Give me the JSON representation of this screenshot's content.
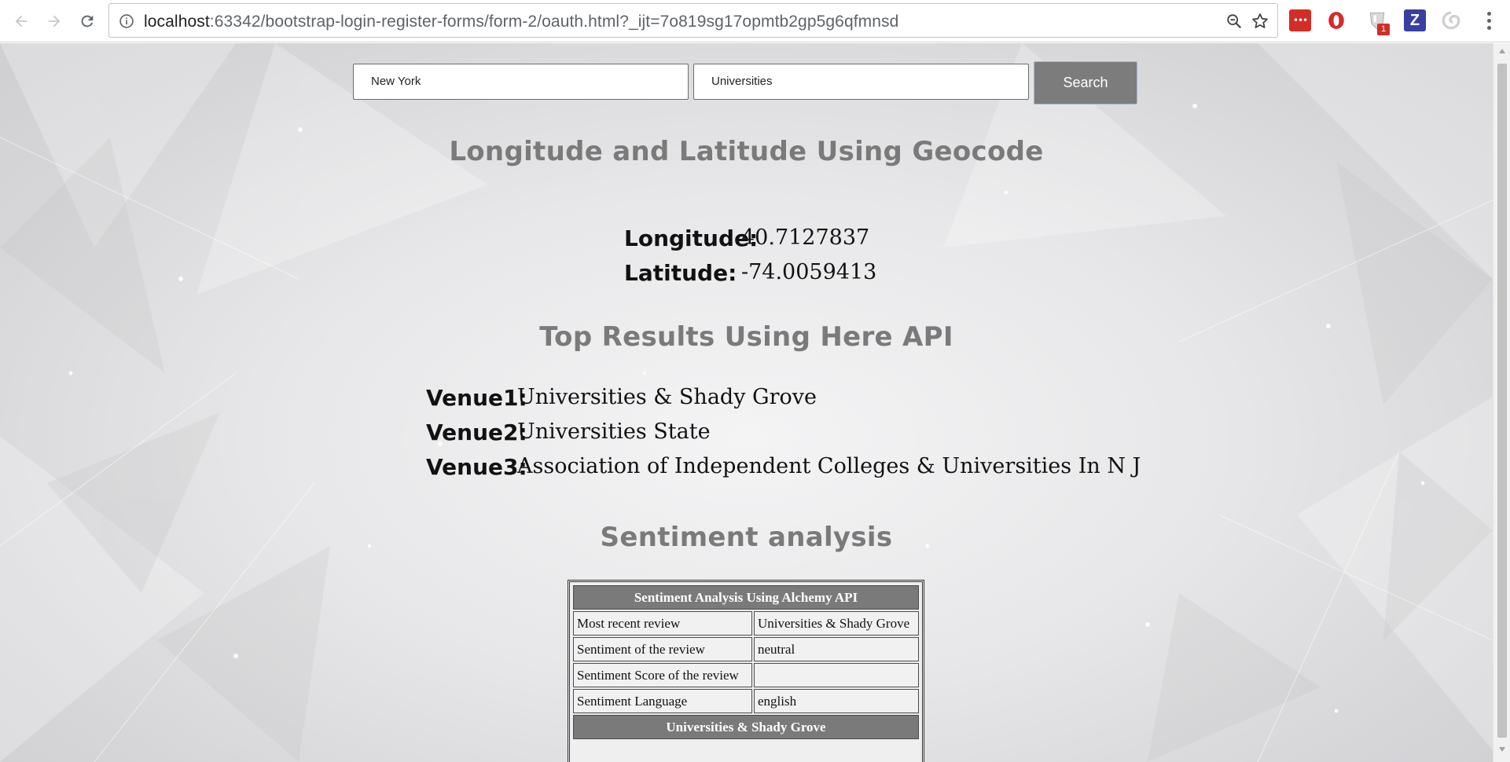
{
  "browser": {
    "url_host": "localhost",
    "url_rest": ":63342/bootstrap-login-register-forms/form-2/oauth.html?_ijt=7o819sg17opmtb2gp5g6qfmnsd",
    "extension_badge": "1",
    "extension_z_label": "Z",
    "extension_lastpass_label": "•••"
  },
  "search": {
    "location_value": "New York",
    "query_value": "Universities",
    "button_label": "Search"
  },
  "geocode": {
    "heading": "Longitude and Latitude Using Geocode",
    "longitude_label": "Longitude:",
    "longitude_value": "40.7127837",
    "latitude_label": "Latitude:",
    "latitude_value": "-74.0059413"
  },
  "top_results": {
    "heading": "Top Results Using Here API",
    "venues": [
      {
        "label": "Venue1:",
        "value": "Universities & Shady Grove"
      },
      {
        "label": "Venue2:",
        "value": "Universities State"
      },
      {
        "label": "Venue3:",
        "value": "Association of Independent Colleges & Universities In N J"
      }
    ]
  },
  "sentiment": {
    "heading": "Sentiment analysis",
    "table_title": "Sentiment Analysis Using Alchemy API",
    "rows": [
      {
        "key": "Most recent review",
        "value": "Universities & Shady Grove"
      },
      {
        "key": "Sentiment of the review",
        "value": "neutral"
      },
      {
        "key": "Sentiment Score of the review",
        "value": ""
      },
      {
        "key": "Sentiment Language",
        "value": "english"
      }
    ],
    "table_footer": "Universities & Shady Grove"
  },
  "colors": {
    "heading": "#7a7a7a",
    "button_bg": "#7c7c7c",
    "table_header_bg": "#7a7a7a"
  }
}
